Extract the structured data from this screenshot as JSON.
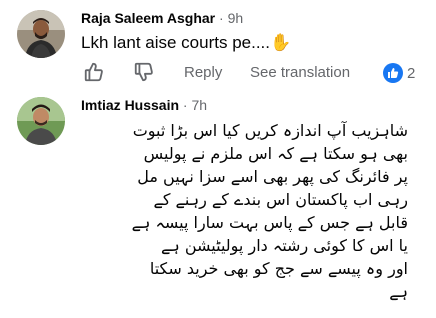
{
  "comments": [
    {
      "author": "Raja Saleem Asghar",
      "separator": "·",
      "time": "9h",
      "text": "Lkh lant aise courts pe....",
      "emoji": "✋",
      "actions": {
        "like_icon": "thumbs-up-icon",
        "dislike_icon": "thumbs-down-icon",
        "reply": "Reply",
        "see_translation": "See translation"
      },
      "reaction": {
        "icon": "like-reaction-icon",
        "count": "2",
        "color": "#1877f2"
      }
    },
    {
      "author": "Imtiaz Hussain",
      "separator": "·",
      "time": "7h",
      "lines": [
        "شاہزیب آپ اندازہ کریں کیا اس بڑا ثبوت",
        "بھی ہو سکتا ہے کہ اس ملزم نے پولیس",
        "پر فائرنگ کی پھر بھی اسے سزا نہیں مل",
        "رہی اب پاکستان اس بندے کے رہنے کے",
        "قابل ہے جس کے پاس بہت سارا پیسہ ہے",
        "یا اس کا کوئی رشتہ دار پولیٹیشن ہے",
        "اور وہ پیسے سے جج کو بھی خرید سکتا",
        "ہے"
      ]
    }
  ]
}
